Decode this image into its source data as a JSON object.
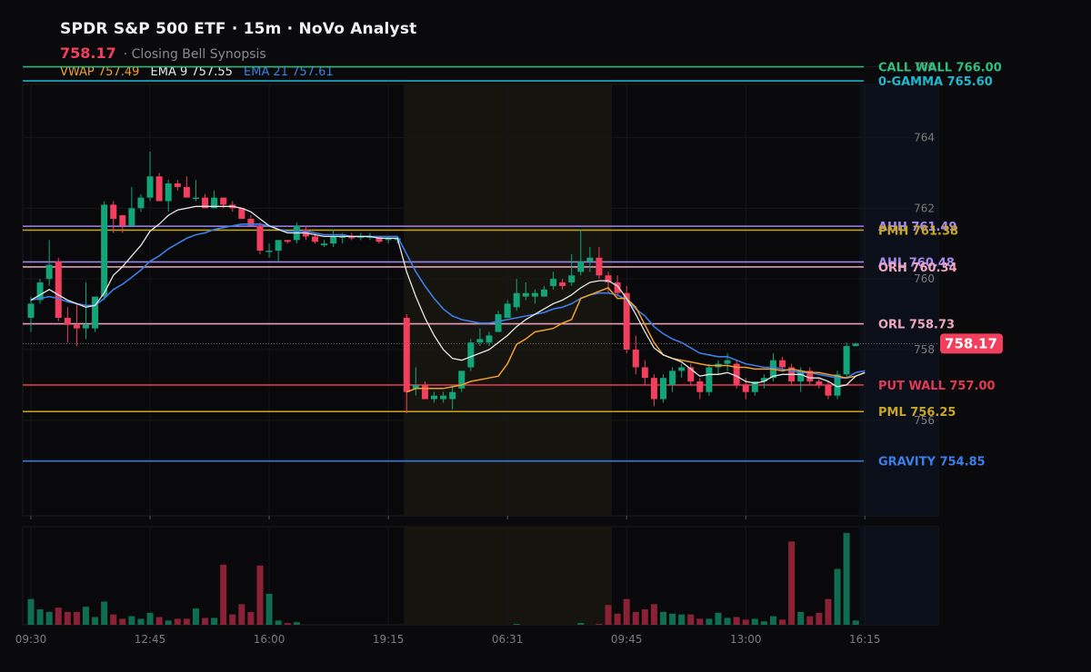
{
  "header": {
    "title": "SPDR S&P 500 ETF · 15m · NoVo Analyst",
    "price": "758.17",
    "synopsis": "· Closing Bell Synopsis",
    "vwap_label": "VWAP 757.49",
    "ema9_label": "EMA 9 757.55",
    "ema21_label": "EMA 21 757.61"
  },
  "price_tag": "758.17",
  "colors": {
    "up": "#13a57a",
    "down": "#f23f5d",
    "vwap": "#f3a02a",
    "ema9": "#e8e8e8",
    "ema21": "#3b7fe6",
    "bg": "#0a0a0c",
    "session": "#16140f"
  },
  "levels": [
    {
      "label": "CALL WALL 766.00",
      "value": 766.0,
      "color": "#2fbf80"
    },
    {
      "label": "0-GAMMA 765.60",
      "value": 765.6,
      "color": "#1fb8cf"
    },
    {
      "label": "AHH 761.49",
      "value": 761.49,
      "color": "#a58cf2"
    },
    {
      "label": "PMH 761.38",
      "value": 761.38,
      "color": "#c9a623"
    },
    {
      "label": "AHL 760.48",
      "value": 760.48,
      "color": "#a58cf2"
    },
    {
      "label": "ORH 760.34",
      "value": 760.34,
      "color": "#f0a6bf"
    },
    {
      "label": "ORL 758.73",
      "value": 758.73,
      "color": "#f0a6bf"
    },
    {
      "label": "PUT WALL 757.00",
      "value": 757.0,
      "color": "#e23a55"
    },
    {
      "label": "PML 756.25",
      "value": 756.25,
      "color": "#c9a623"
    },
    {
      "label": "GRAVITY 754.85",
      "value": 754.85,
      "color": "#3b7fe6"
    }
  ],
  "chart_data": {
    "type": "candlestick",
    "ylim": [
      753.3,
      765.5
    ],
    "yticks": [
      "756",
      "758",
      "760",
      "762",
      "764",
      "766"
    ],
    "xticks": [
      {
        "label": "09:30",
        "i": 0
      },
      {
        "label": "12:45",
        "i": 13
      },
      {
        "label": "16:00",
        "i": 26
      },
      {
        "label": "19:15",
        "i": 39
      },
      {
        "label": "06:31",
        "i": 52
      },
      {
        "label": "09:45",
        "i": 65
      },
      {
        "label": "13:00",
        "i": 78
      },
      {
        "label": "16:15",
        "i": 91
      }
    ],
    "candles": [
      {
        "o": 758.9,
        "h": 759.5,
        "l": 758.5,
        "c": 759.3,
        "v": 30
      },
      {
        "o": 759.4,
        "h": 760.0,
        "l": 759.3,
        "c": 759.9,
        "v": 18
      },
      {
        "o": 760.0,
        "h": 761.1,
        "l": 759.8,
        "c": 760.4,
        "v": 15
      },
      {
        "o": 760.5,
        "h": 760.6,
        "l": 758.8,
        "c": 758.9,
        "v": 20
      },
      {
        "o": 758.9,
        "h": 759.2,
        "l": 758.2,
        "c": 758.7,
        "v": 15
      },
      {
        "o": 758.7,
        "h": 759.3,
        "l": 758.1,
        "c": 758.6,
        "v": 15
      },
      {
        "o": 758.6,
        "h": 759.9,
        "l": 758.3,
        "c": 758.7,
        "v": 21
      },
      {
        "o": 758.6,
        "h": 759.5,
        "l": 758.5,
        "c": 759.5,
        "v": 9
      },
      {
        "o": 759.5,
        "h": 762.2,
        "l": 759.4,
        "c": 762.1,
        "v": 27
      },
      {
        "o": 762.1,
        "h": 762.2,
        "l": 761.3,
        "c": 761.7,
        "v": 12
      },
      {
        "o": 761.8,
        "h": 761.8,
        "l": 761.3,
        "c": 761.5,
        "v": 7
      },
      {
        "o": 761.5,
        "h": 762.6,
        "l": 761.5,
        "c": 762.0,
        "v": 10
      },
      {
        "o": 762.0,
        "h": 762.4,
        "l": 761.9,
        "c": 762.3,
        "v": 7
      },
      {
        "o": 762.3,
        "h": 763.6,
        "l": 762.2,
        "c": 762.9,
        "v": 14
      },
      {
        "o": 762.9,
        "h": 763.0,
        "l": 762.2,
        "c": 762.2,
        "v": 9
      },
      {
        "o": 762.2,
        "h": 762.8,
        "l": 761.9,
        "c": 762.7,
        "v": 5
      },
      {
        "o": 762.7,
        "h": 762.8,
        "l": 762.5,
        "c": 762.6,
        "v": 7
      },
      {
        "o": 762.6,
        "h": 762.9,
        "l": 762.3,
        "c": 762.3,
        "v": 7
      },
      {
        "o": 762.3,
        "h": 762.8,
        "l": 762.2,
        "c": 762.3,
        "v": 19
      },
      {
        "o": 762.3,
        "h": 762.4,
        "l": 762.0,
        "c": 762.0,
        "v": 8
      },
      {
        "o": 762.0,
        "h": 762.5,
        "l": 762.0,
        "c": 762.3,
        "v": 8
      },
      {
        "o": 762.3,
        "h": 762.3,
        "l": 762.0,
        "c": 762.1,
        "v": 70
      },
      {
        "o": 762.1,
        "h": 762.2,
        "l": 761.9,
        "c": 762.0,
        "v": 12
      },
      {
        "o": 762.0,
        "h": 762.0,
        "l": 761.7,
        "c": 761.7,
        "v": 24
      },
      {
        "o": 761.7,
        "h": 761.8,
        "l": 761.5,
        "c": 761.5,
        "v": 15
      },
      {
        "o": 761.5,
        "h": 761.6,
        "l": 760.7,
        "c": 760.8,
        "v": 69
      },
      {
        "o": 760.8,
        "h": 761.0,
        "l": 760.6,
        "c": 760.8,
        "v": 36
      },
      {
        "o": 760.8,
        "h": 761.1,
        "l": 760.5,
        "c": 761.1,
        "v": 5
      },
      {
        "o": 761.1,
        "h": 761.1,
        "l": 761.0,
        "c": 761.05,
        "v": 2
      },
      {
        "o": 761.1,
        "h": 761.6,
        "l": 761.0,
        "c": 761.5,
        "v": 3
      },
      {
        "o": 761.4,
        "h": 761.5,
        "l": 761.1,
        "c": 761.2,
        "v": 0
      },
      {
        "o": 761.2,
        "h": 761.3,
        "l": 761.0,
        "c": 761.05,
        "v": 0
      },
      {
        "o": 760.95,
        "h": 761.1,
        "l": 760.9,
        "c": 761.0,
        "v": 0
      },
      {
        "o": 761.0,
        "h": 761.4,
        "l": 760.9,
        "c": 761.2,
        "v": 0
      },
      {
        "o": 761.2,
        "h": 761.3,
        "l": 761.0,
        "c": 761.2,
        "v": 0
      },
      {
        "o": 761.2,
        "h": 761.3,
        "l": 761.1,
        "c": 761.15,
        "v": 0
      },
      {
        "o": 761.2,
        "h": 761.3,
        "l": 761.1,
        "c": 761.2,
        "v": 0
      },
      {
        "o": 761.2,
        "h": 761.3,
        "l": 761.1,
        "c": 761.2,
        "v": 0
      },
      {
        "o": 761.2,
        "h": 761.2,
        "l": 761.0,
        "c": 761.05,
        "v": 0
      },
      {
        "o": 761.1,
        "h": 761.2,
        "l": 761.0,
        "c": 761.15,
        "v": 0
      },
      {
        "o": 761.1,
        "h": 761.2,
        "l": 761.0,
        "c": 761.15,
        "v": 0
      },
      {
        "o": 758.9,
        "h": 759.0,
        "l": 756.2,
        "c": 756.8,
        "v": 0
      },
      {
        "o": 756.9,
        "h": 757.5,
        "l": 756.7,
        "c": 757.0,
        "v": 0
      },
      {
        "o": 757.0,
        "h": 757.1,
        "l": 756.6,
        "c": 756.6,
        "v": 0
      },
      {
        "o": 756.6,
        "h": 756.8,
        "l": 756.5,
        "c": 756.7,
        "v": 0
      },
      {
        "o": 756.6,
        "h": 756.8,
        "l": 756.5,
        "c": 756.7,
        "v": 0
      },
      {
        "o": 756.6,
        "h": 757.0,
        "l": 756.3,
        "c": 756.8,
        "v": 0
      },
      {
        "o": 756.9,
        "h": 757.4,
        "l": 756.8,
        "c": 757.4,
        "v": 0
      },
      {
        "o": 757.5,
        "h": 758.3,
        "l": 757.4,
        "c": 758.2,
        "v": 0
      },
      {
        "o": 758.2,
        "h": 758.6,
        "l": 758.1,
        "c": 758.3,
        "v": 0
      },
      {
        "o": 758.2,
        "h": 758.5,
        "l": 758.1,
        "c": 758.4,
        "v": 0
      },
      {
        "o": 758.5,
        "h": 759.1,
        "l": 758.5,
        "c": 759.0,
        "v": 0
      },
      {
        "o": 758.9,
        "h": 759.4,
        "l": 758.9,
        "c": 759.3,
        "v": 0
      },
      {
        "o": 759.2,
        "h": 760.0,
        "l": 759.1,
        "c": 759.6,
        "v": 1
      },
      {
        "o": 759.5,
        "h": 759.9,
        "l": 759.4,
        "c": 759.6,
        "v": 0
      },
      {
        "o": 759.5,
        "h": 759.7,
        "l": 759.3,
        "c": 759.6,
        "v": 0
      },
      {
        "o": 759.5,
        "h": 759.8,
        "l": 759.5,
        "c": 759.7,
        "v": 0
      },
      {
        "o": 759.8,
        "h": 760.2,
        "l": 759.7,
        "c": 760.0,
        "v": 0
      },
      {
        "o": 759.9,
        "h": 760.0,
        "l": 759.7,
        "c": 759.8,
        "v": 0
      },
      {
        "o": 759.9,
        "h": 760.7,
        "l": 759.8,
        "c": 760.1,
        "v": 0
      },
      {
        "o": 760.2,
        "h": 761.4,
        "l": 760.1,
        "c": 760.5,
        "v": 2
      },
      {
        "o": 760.5,
        "h": 760.9,
        "l": 760.2,
        "c": 760.6,
        "v": 0
      },
      {
        "o": 760.6,
        "h": 760.9,
        "l": 760.0,
        "c": 760.1,
        "v": 1
      },
      {
        "o": 760.1,
        "h": 760.2,
        "l": 759.6,
        "c": 759.9,
        "v": 23
      },
      {
        "o": 759.9,
        "h": 760.1,
        "l": 759.5,
        "c": 759.6,
        "v": 13
      },
      {
        "o": 759.6,
        "h": 759.8,
        "l": 757.9,
        "c": 758.0,
        "v": 30
      },
      {
        "o": 758.0,
        "h": 758.4,
        "l": 757.3,
        "c": 757.5,
        "v": 15
      },
      {
        "o": 757.5,
        "h": 757.7,
        "l": 757.0,
        "c": 757.2,
        "v": 18
      },
      {
        "o": 757.2,
        "h": 757.3,
        "l": 756.4,
        "c": 756.6,
        "v": 24
      },
      {
        "o": 756.6,
        "h": 757.3,
        "l": 756.5,
        "c": 757.2,
        "v": 15
      },
      {
        "o": 757.0,
        "h": 757.5,
        "l": 756.8,
        "c": 757.4,
        "v": 13
      },
      {
        "o": 757.4,
        "h": 757.6,
        "l": 757.2,
        "c": 757.5,
        "v": 12
      },
      {
        "o": 757.5,
        "h": 757.6,
        "l": 757.0,
        "c": 757.1,
        "v": 12
      },
      {
        "o": 757.1,
        "h": 757.2,
        "l": 756.6,
        "c": 756.8,
        "v": 7
      },
      {
        "o": 756.8,
        "h": 757.6,
        "l": 756.7,
        "c": 757.5,
        "v": 7
      },
      {
        "o": 757.5,
        "h": 757.7,
        "l": 757.3,
        "c": 757.6,
        "v": 14
      },
      {
        "o": 757.6,
        "h": 757.9,
        "l": 757.4,
        "c": 757.7,
        "v": 8
      },
      {
        "o": 757.6,
        "h": 757.7,
        "l": 756.9,
        "c": 757.0,
        "v": 9
      },
      {
        "o": 757.0,
        "h": 757.2,
        "l": 756.6,
        "c": 756.8,
        "v": 6
      },
      {
        "o": 756.8,
        "h": 757.1,
        "l": 756.7,
        "c": 757.1,
        "v": 7
      },
      {
        "o": 757.1,
        "h": 757.3,
        "l": 756.9,
        "c": 757.2,
        "v": 4
      },
      {
        "o": 757.2,
        "h": 757.9,
        "l": 757.1,
        "c": 757.7,
        "v": 10
      },
      {
        "o": 757.7,
        "h": 757.8,
        "l": 757.4,
        "c": 757.5,
        "v": 6
      },
      {
        "o": 757.5,
        "h": 757.6,
        "l": 757.0,
        "c": 757.1,
        "v": 97
      },
      {
        "o": 757.1,
        "h": 757.5,
        "l": 756.8,
        "c": 757.4,
        "v": 15
      },
      {
        "o": 757.4,
        "h": 757.5,
        "l": 757.0,
        "c": 757.1,
        "v": 10
      },
      {
        "o": 757.1,
        "h": 757.2,
        "l": 756.9,
        "c": 757.0,
        "v": 14
      },
      {
        "o": 757.0,
        "h": 757.1,
        "l": 756.6,
        "c": 756.7,
        "v": 30
      },
      {
        "o": 756.7,
        "h": 757.4,
        "l": 756.6,
        "c": 757.3,
        "v": 65
      },
      {
        "o": 757.3,
        "h": 758.2,
        "l": 757.2,
        "c": 758.1,
        "v": 107
      },
      {
        "o": 758.1,
        "h": 758.2,
        "l": 758.1,
        "c": 758.17,
        "v": 5
      }
    ],
    "ema9": [
      759.4,
      759.55,
      759.7,
      759.55,
      759.4,
      759.3,
      759.2,
      759.25,
      759.6,
      760.1,
      760.35,
      760.65,
      760.95,
      761.35,
      761.55,
      761.8,
      761.95,
      762.0,
      762.05,
      762.05,
      762.05,
      762.05,
      762.05,
      762.0,
      761.9,
      761.7,
      761.5,
      761.4,
      761.3,
      761.3,
      761.3,
      761.25,
      761.2,
      761.2,
      761.2,
      761.2,
      761.2,
      761.2,
      761.15,
      761.15,
      761.15,
      760.2,
      759.5,
      758.9,
      758.4,
      758.0,
      757.75,
      757.7,
      757.8,
      757.9,
      758.0,
      758.2,
      758.4,
      758.65,
      758.85,
      759.0,
      759.15,
      759.3,
      759.4,
      759.55,
      759.75,
      759.9,
      759.95,
      759.95,
      759.8,
      759.45,
      759.0,
      758.5,
      758.05,
      757.85,
      757.75,
      757.65,
      757.45,
      757.25,
      757.3,
      757.3,
      757.35,
      757.25,
      757.1,
      757.05,
      757.1,
      757.25,
      757.3,
      757.3,
      757.3,
      757.2,
      757.2,
      757.1,
      756.95,
      757.0,
      757.25,
      757.35
    ],
    "ema21": [
      759.4,
      759.45,
      759.5,
      759.45,
      759.35,
      759.3,
      759.25,
      759.25,
      759.45,
      759.7,
      759.85,
      760.05,
      760.25,
      760.5,
      760.65,
      760.85,
      761.0,
      761.15,
      761.25,
      761.3,
      761.4,
      761.45,
      761.5,
      761.55,
      761.55,
      761.55,
      761.5,
      761.4,
      761.35,
      761.35,
      761.35,
      761.3,
      761.25,
      761.25,
      761.25,
      761.2,
      761.2,
      761.2,
      761.2,
      761.2,
      761.2,
      760.7,
      760.2,
      759.8,
      759.45,
      759.15,
      758.95,
      758.85,
      758.8,
      758.75,
      758.75,
      758.8,
      758.85,
      758.9,
      758.95,
      759.0,
      759.05,
      759.15,
      759.2,
      759.3,
      759.45,
      759.55,
      759.6,
      759.6,
      759.55,
      759.4,
      759.15,
      758.95,
      758.65,
      758.45,
      758.3,
      758.2,
      758.05,
      757.9,
      757.85,
      757.8,
      757.8,
      757.7,
      757.6,
      757.55,
      757.5,
      757.5,
      757.45,
      757.4,
      757.35,
      757.35,
      757.3,
      757.25,
      757.2,
      757.2,
      757.35,
      757.4
    ],
    "vwap": {
      "start": 41,
      "values": [
        756.8,
        756.9,
        756.9,
        756.9,
        756.9,
        756.95,
        757.0,
        757.1,
        757.15,
        757.2,
        757.25,
        757.6,
        758.15,
        758.3,
        758.5,
        758.55,
        758.6,
        758.75,
        758.85,
        759.45,
        759.55,
        759.65,
        759.75,
        759.45,
        759.45,
        759.2,
        758.7,
        758.2,
        757.85,
        757.75,
        757.7,
        757.65,
        757.6,
        757.55,
        757.55,
        757.55,
        757.5,
        757.5,
        757.45,
        757.45,
        757.45,
        757.4,
        757.45,
        757.4,
        757.35,
        757.35,
        757.3,
        757.25,
        757.2,
        757.25,
        757.35
      ]
    },
    "sessions": [
      {
        "from": 41,
        "to": 63
      }
    ]
  }
}
